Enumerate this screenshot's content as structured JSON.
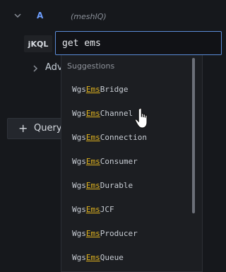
{
  "query_row": {
    "ref_letter": "A",
    "datasource": "(meshIQ)"
  },
  "editor": {
    "language_label": "jKQL",
    "query_value": "get ems"
  },
  "advanced": {
    "label": "Adv"
  },
  "add_query": {
    "label": "Query"
  },
  "suggestions": {
    "header": "Suggestions",
    "items": [
      {
        "prefix": "Wgs",
        "match": "Ems",
        "suffix": "Bridge"
      },
      {
        "prefix": "Wgs",
        "match": "Ems",
        "suffix": "Channel"
      },
      {
        "prefix": "Wgs",
        "match": "Ems",
        "suffix": "Connection"
      },
      {
        "prefix": "Wgs",
        "match": "Ems",
        "suffix": "Consumer"
      },
      {
        "prefix": "Wgs",
        "match": "Ems",
        "suffix": "Durable"
      },
      {
        "prefix": "Wgs",
        "match": "Ems",
        "suffix": "JCF"
      },
      {
        "prefix": "Wgs",
        "match": "Ems",
        "suffix": "Producer"
      },
      {
        "prefix": "Wgs",
        "match": "Ems",
        "suffix": "Queue"
      }
    ]
  },
  "colors": {
    "background": "#16181c",
    "accent_blue": "#5a8bd6",
    "match_highlight": "#e0b31f"
  }
}
